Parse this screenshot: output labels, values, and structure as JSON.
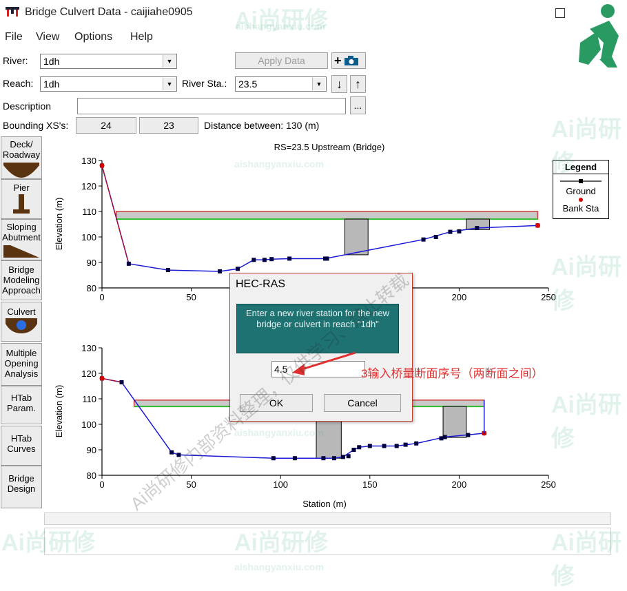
{
  "window": {
    "title": "Bridge Culvert Data - caijiahe0905"
  },
  "menu": [
    "File",
    "View",
    "Options",
    "Help"
  ],
  "form": {
    "river_label": "River:",
    "river_value": "1dh",
    "reach_label": "Reach:",
    "reach_value": "1dh",
    "river_sta_label": "River Sta.:",
    "river_sta_value": "23.5",
    "apply_label": "Apply Data",
    "description_label": "Description",
    "description_more": "...",
    "bounding_label": "Bounding XS's:",
    "bounding_up": "24",
    "bounding_down": "23",
    "distance_text": "Distance between: 130 (m)"
  },
  "toolbar": {
    "add_label": "+",
    "up_arrow": "↑",
    "down_arrow": "↓"
  },
  "sidebar": [
    {
      "label": "Deck/ Roadway",
      "icon": "deck-icon"
    },
    {
      "label": "Pier",
      "icon": "pier-icon"
    },
    {
      "label": "Sloping Abutment",
      "icon": "abutment-icon"
    },
    {
      "label": "Bridge Modeling Approach",
      "icon": ""
    },
    {
      "label": "Culvert",
      "icon": "culvert-icon"
    },
    {
      "label": "Multiple Opening Analysis",
      "icon": ""
    },
    {
      "label": "HTab Param.",
      "icon": ""
    },
    {
      "label": "HTab Curves",
      "icon": ""
    },
    {
      "label": "Bridge Design",
      "icon": ""
    }
  ],
  "plot": {
    "title": "RS=23.5   Upstream  (Bridge)",
    "xlabel": "Station (m)",
    "ylabel": "Elevation (m)",
    "legend_title": "Legend",
    "legend_items": [
      "Ground",
      "Bank Sta"
    ],
    "colors": {
      "ground": "#1a1ad6",
      "bank": "#d60000",
      "deck_top": "#d03a3a",
      "deck_bottom": "#2fbf2f",
      "pier": "#b8b8b8"
    }
  },
  "chart_data": [
    {
      "type": "line",
      "xlim": [
        0,
        250
      ],
      "ylim": [
        80,
        130
      ],
      "xticks": [
        0,
        50,
        100,
        150,
        200,
        250
      ],
      "yticks": [
        80,
        90,
        100,
        110,
        120,
        130
      ],
      "ground": {
        "x": [
          0,
          15,
          37,
          66,
          76,
          85,
          91,
          95,
          105,
          125,
          180,
          195,
          210,
          244
        ],
        "y": [
          128,
          89.5,
          87,
          86.5,
          87.5,
          91,
          91,
          91.3,
          91.5,
          91.5,
          99,
          102,
          103.5,
          104.5
        ]
      },
      "ground_extra": {
        "x": [
          126,
          187,
          200
        ],
        "y": [
          91.5,
          100,
          102.2
        ]
      },
      "bank_sta": {
        "x": [
          0,
          244
        ],
        "y": [
          128,
          104.5
        ]
      },
      "deck": {
        "x_start": 8,
        "x_end": 244,
        "high_chord": 110,
        "low_chord": 107
      },
      "piers": [
        {
          "x_start": 136,
          "x_end": 149
        },
        {
          "x_start": 204,
          "x_end": 217
        }
      ]
    },
    {
      "type": "line",
      "xlim": [
        0,
        250
      ],
      "ylim": [
        80,
        130
      ],
      "xticks": [
        0,
        50,
        100,
        150,
        200,
        250
      ],
      "yticks": [
        80,
        90,
        100,
        110,
        120,
        130
      ],
      "ground": {
        "x": [
          0,
          11,
          39,
          43,
          96,
          108,
          130,
          135,
          141,
          144,
          150,
          158,
          165,
          176,
          192,
          214
        ],
        "y": [
          118,
          116.5,
          89,
          88,
          86.7,
          86.7,
          86.7,
          87.2,
          90,
          91,
          91.5,
          91.5,
          91.5,
          92.5,
          95,
          96.5
        ],
        "extra": {
          "x": [
            124,
            138,
            170,
            190,
            205
          ],
          "y": [
            86.7,
            87.5,
            92,
            94.5,
            95.8
          ]
        }
      },
      "bank_sta": {
        "x": [
          0,
          214
        ],
        "y": [
          118,
          96.5
        ]
      },
      "deck": {
        "x_start": 18,
        "x_end": 214,
        "high_chord": 109.5,
        "low_chord": 107
      },
      "piers": [
        {
          "x_start": 120,
          "x_end": 134
        },
        {
          "x_start": 191,
          "x_end": 204
        }
      ]
    }
  ],
  "dialog": {
    "title": "HEC-RAS",
    "prompt": "Enter a new river station for the new bridge or culvert in reach \"1dh\"",
    "input_value": "4.5",
    "ok_label": "OK",
    "cancel_label": "Cancel"
  },
  "annotation": {
    "text": "3输入桥量断面序号（两断面之间）",
    "color": "#e03030"
  },
  "watermarks": {
    "brand": "Ai尚研修",
    "url": "aishangyanxiu.com",
    "diag1": "Ai尚研修内部资料整理，仅供学习、禁止转载"
  }
}
